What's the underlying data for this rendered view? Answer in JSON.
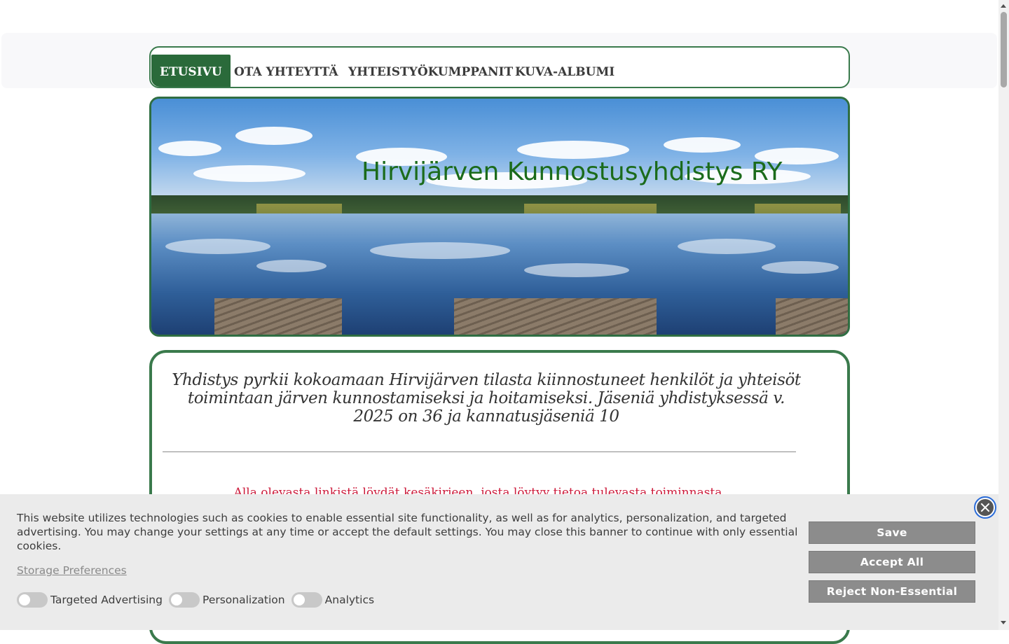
{
  "nav": {
    "items": [
      {
        "label": "ETUSIVU",
        "active": true
      },
      {
        "label": "OTA YHTEYTTÄ",
        "active": false
      },
      {
        "label": "YHTEISTYÖKUMPPANIT",
        "active": false
      },
      {
        "label": "KUVA-ALBUMI",
        "active": false
      }
    ]
  },
  "hero": {
    "title": "Hirvijärven Kunnostusyhdistys RY",
    "image": "lake-landscape"
  },
  "content": {
    "intro": "Yhdistys pyrkii kokoamaan Hirvijärven tilasta kiinnostuneet henkilöt ja yhteisöt toimintaan järven kunnostamiseksi ja hoitamiseksi. Jäseniä yhdistyksessä v. 2025 on 36  ja kannatusjäseniä 10",
    "link_note": "Alla olevasta linkistä löydät kesäkirjeen, josta löytyy tietoa tulevasta toiminnasta"
  },
  "cookie_banner": {
    "text": "This website utilizes technologies such as cookies to enable essential site functionality, as well as for analytics, personalization, and targeted advertising. You may change your settings at any time or accept the default settings. You may close this banner to continue with only essential cookies.",
    "preferences_link": "Storage Preferences",
    "toggles": [
      {
        "label": "Targeted Advertising",
        "on": false
      },
      {
        "label": "Personalization",
        "on": false
      },
      {
        "label": "Analytics",
        "on": false
      }
    ],
    "buttons": {
      "save": "Save",
      "accept_all": "Accept All",
      "reject": "Reject Non-Essential"
    },
    "close_icon": "close-icon"
  },
  "colors": {
    "accent_green": "#2a6a3a",
    "title_green": "#1b6b1b",
    "link_red": "#cc1a3a",
    "button_gray": "#8c8c8c"
  }
}
